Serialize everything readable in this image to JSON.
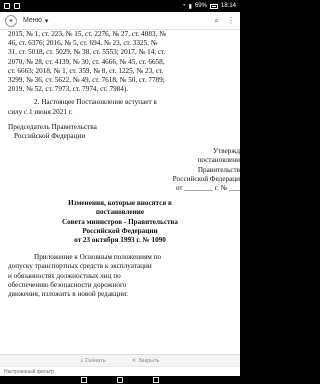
{
  "status": {
    "battery": "69%",
    "time": "18:14"
  },
  "appbar": {
    "menu_label": "Меню"
  },
  "document": {
    "lines_top": [
      "2015, № 1, ст. 223, № 15, ст. 2276, № 27, ст. 4083, №",
      "46, ст. 6376; 2016, № 5, ст. 694, № 23, ст. 3325, №",
      "31, ст. 5018, ст. 5029, № 38, ст. 5553; 2017, № 14, ст.",
      "2070, № 28, ст. 4139, № 30, ст. 4666, № 45, ст. 6658,",
      "ст. 6663; 2018, № 1, ст. 359, № 8, ст. 1225, № 23, ст.",
      "3299, № 36, ст. 5622, № 49, ст. 7618, № 50, ст. 7789;",
      "2019, № 52, ст. 7973, ст. 7974, ст. 7984)."
    ],
    "clause2": [
      "2. Настоящее Постановление вступает в",
      "силу с 1 июня 2021 г."
    ],
    "signature": [
      "Председатель Правительства",
      "Российской Федерации"
    ],
    "approve": [
      "Утвержд",
      "постановлени",
      "Правительств",
      "Российской Федераци",
      "от ________ г. № ___"
    ],
    "title": [
      "Изменения, которые вносятся в",
      "постановление",
      "Совета министров - Правительства",
      "Российской Федерации",
      "от 23 октября 1993 г. № 1090"
    ],
    "annex": [
      "Приложение к Основным положениям по",
      "допуску транспортных средств к эксплуатации",
      "и обязанностях должностных лиц по",
      "обеспечению безопасности дорожного",
      "движения, изложить в новой редакции:"
    ]
  },
  "docbar": {
    "download": "Скачать",
    "close": "Закрыть"
  },
  "filter": {
    "label": "Настроенный фильтр"
  }
}
